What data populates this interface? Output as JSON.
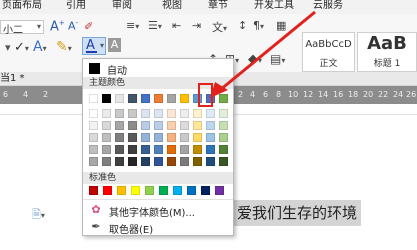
{
  "ribbon_tabs": [
    "页面布局",
    "引用",
    "审阅",
    "视图",
    "章节",
    "开发工具",
    "云服务"
  ],
  "ribbon": {
    "font_size_value": "小二",
    "font_color_button": "A",
    "highlight_button": "A",
    "clear_format_button": "A",
    "text_effect_button": "A",
    "char_shading_button": "A"
  },
  "styles": [
    {
      "sample": "AaBbCcD",
      "name": "正文"
    },
    {
      "sample": "AaB",
      "name": "标题 1"
    }
  ],
  "document": {
    "tab_label": "当1 *",
    "selected_text": "爱我们生存的环境"
  },
  "ruler_numbers": [
    "6",
    "4",
    "2",
    "2",
    "4",
    "6",
    "8",
    "10",
    "12",
    "14",
    "16",
    "18",
    "20",
    "22",
    "24",
    "26"
  ],
  "dropdown": {
    "auto_label": "自动",
    "theme_colors_title": "主题颜色",
    "standard_colors_title": "标准色",
    "more_colors_label": "其他字体颜色(M)...",
    "eyedropper_label": "取色器(E)",
    "theme_colors": [
      [
        "#ffffff",
        "#ebebeb",
        "#c9c9c9",
        "#c9c9c9",
        "#dbe4f0",
        "#dce6f2",
        "#fce7d6",
        "#ededed",
        "#fff2cc",
        "#deebf7",
        "#e2efda"
      ],
      [
        "#f2f2f2",
        "#d9d9d9",
        "#a6a6a6",
        "#8c8c8c",
        "#b8cce4",
        "#b9cde5",
        "#f9cfae",
        "#dbdbdb",
        "#ffe699",
        "#bdd7ee",
        "#c6e0b4"
      ],
      [
        "#d9d9d9",
        "#bfbfbf",
        "#808080",
        "#5a5a5a",
        "#95b3d7",
        "#95b3d7",
        "#f5b17f",
        "#c9c9c9",
        "#ffd966",
        "#9dc3e6",
        "#a9d08e"
      ],
      [
        "#bfbfbf",
        "#a6a6a6",
        "#595959",
        "#3f3f3f",
        "#366092",
        "#4f81bd",
        "#e26b0a",
        "#a5a5a5",
        "#bf8f00",
        "#2e75b6",
        "#548235"
      ],
      [
        "#a6a6a6",
        "#7f7f7f",
        "#404040",
        "#262626",
        "#244062",
        "#2f5597",
        "#974706",
        "#7b7b7b",
        "#7f6000",
        "#1f4e79",
        "#385723"
      ]
    ],
    "theme_top_row": [
      "#ffffff",
      "#000000",
      "#e7e6e6",
      "#44546a",
      "#4472c4",
      "#ed7d31",
      "#a5a5a5",
      "#ffc000",
      "#5b9bd5",
      "#4f6fbd",
      "#70ad47"
    ],
    "standard_colors": [
      "#c00000",
      "#ff0000",
      "#ffc000",
      "#ffff00",
      "#92d050",
      "#00b050",
      "#00b0f0",
      "#0070c0",
      "#002060",
      "#7030a0"
    ]
  }
}
